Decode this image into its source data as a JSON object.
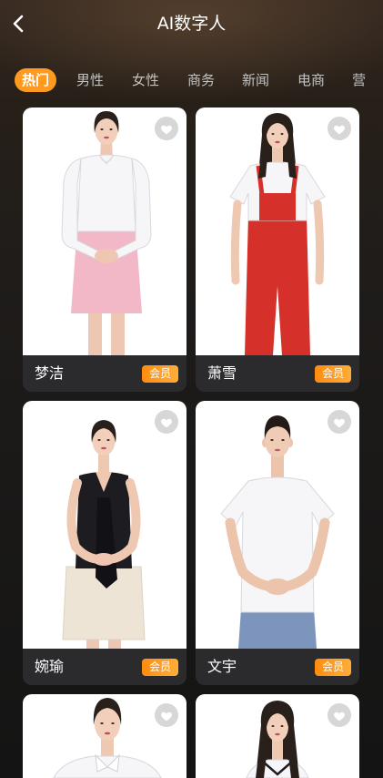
{
  "header": {
    "title": "AI数字人",
    "back_icon": "chevron-left-icon"
  },
  "tabs": [
    {
      "label": "热门",
      "active": true
    },
    {
      "label": "男性",
      "active": false
    },
    {
      "label": "女性",
      "active": false
    },
    {
      "label": "商务",
      "active": false
    },
    {
      "label": "新闻",
      "active": false
    },
    {
      "label": "电商",
      "active": false
    },
    {
      "label": "营",
      "active": false
    }
  ],
  "cards": [
    {
      "name": "梦洁",
      "badge": "会员"
    },
    {
      "name": "萧雪",
      "badge": "会员"
    },
    {
      "name": "婉瑜",
      "badge": "会员"
    },
    {
      "name": "文宇",
      "badge": "会员"
    }
  ],
  "favorite_icon": "heart-icon",
  "theme": {
    "accent": "#ff9a1f",
    "card_footer": "#2b2b2d",
    "tab_text": "#c2c2c2"
  }
}
